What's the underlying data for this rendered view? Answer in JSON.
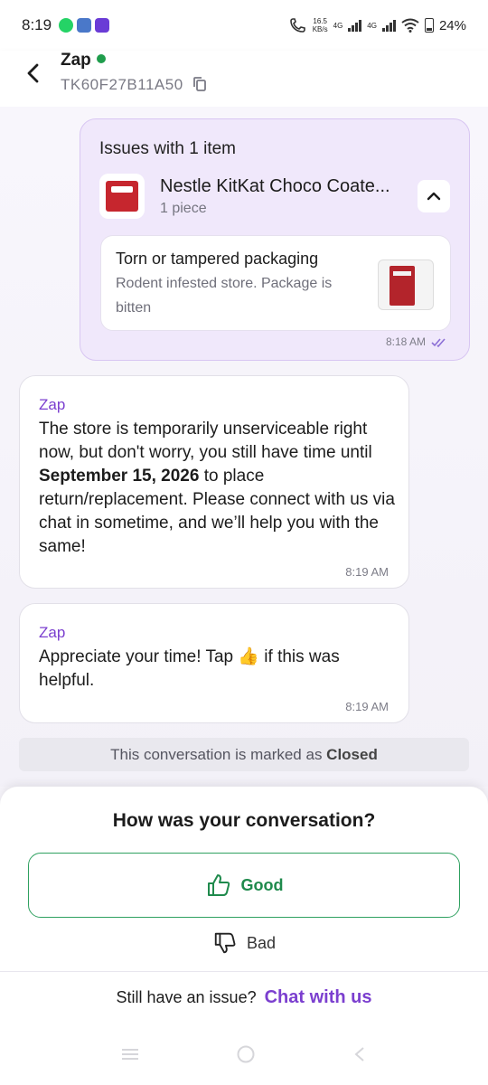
{
  "status_bar": {
    "time": "8:19",
    "net_speed_value": "16.5",
    "net_speed_unit": "KB/s",
    "net_type_1": "4G",
    "net_type_2": "4G",
    "battery": "24%"
  },
  "header": {
    "title": "Zap",
    "ticket_id": "TK60F27B11A50"
  },
  "issue_card": {
    "heading": "Issues with 1 item",
    "product_name": "Nestle KitKat Choco Coate...",
    "product_qty": "1 piece",
    "reason_title": "Torn or tampered packaging",
    "reason_desc": "Rodent infested store. Package is bitten",
    "time": "8:18 AM"
  },
  "messages": [
    {
      "sender": "Zap",
      "text_before": "The store is temporarily unserviceable right now, but don't worry, you still have time until ",
      "text_bold": "September 15, 2026",
      "text_after": " to place return/replacement. Please connect with us via chat in sometime, and we’ll help you with the same!",
      "time": "8:19 AM"
    },
    {
      "sender": "Zap",
      "text": "Appreciate your time! Tap 👍 if this was helpful.",
      "time": "8:19 AM"
    }
  ],
  "closed_banner": {
    "text": "This conversation is marked as ",
    "status": "Closed"
  },
  "feedback": {
    "title": "How was your conversation?",
    "good_label": "Good",
    "bad_label": "Bad",
    "still_issue": "Still have an issue?",
    "chat_link": "Chat with us"
  },
  "colors": {
    "accent_purple": "#7b3fcf",
    "good_green": "#2fa160",
    "online_green": "#1f9d4c",
    "issue_bg": "#f0e8fb"
  }
}
